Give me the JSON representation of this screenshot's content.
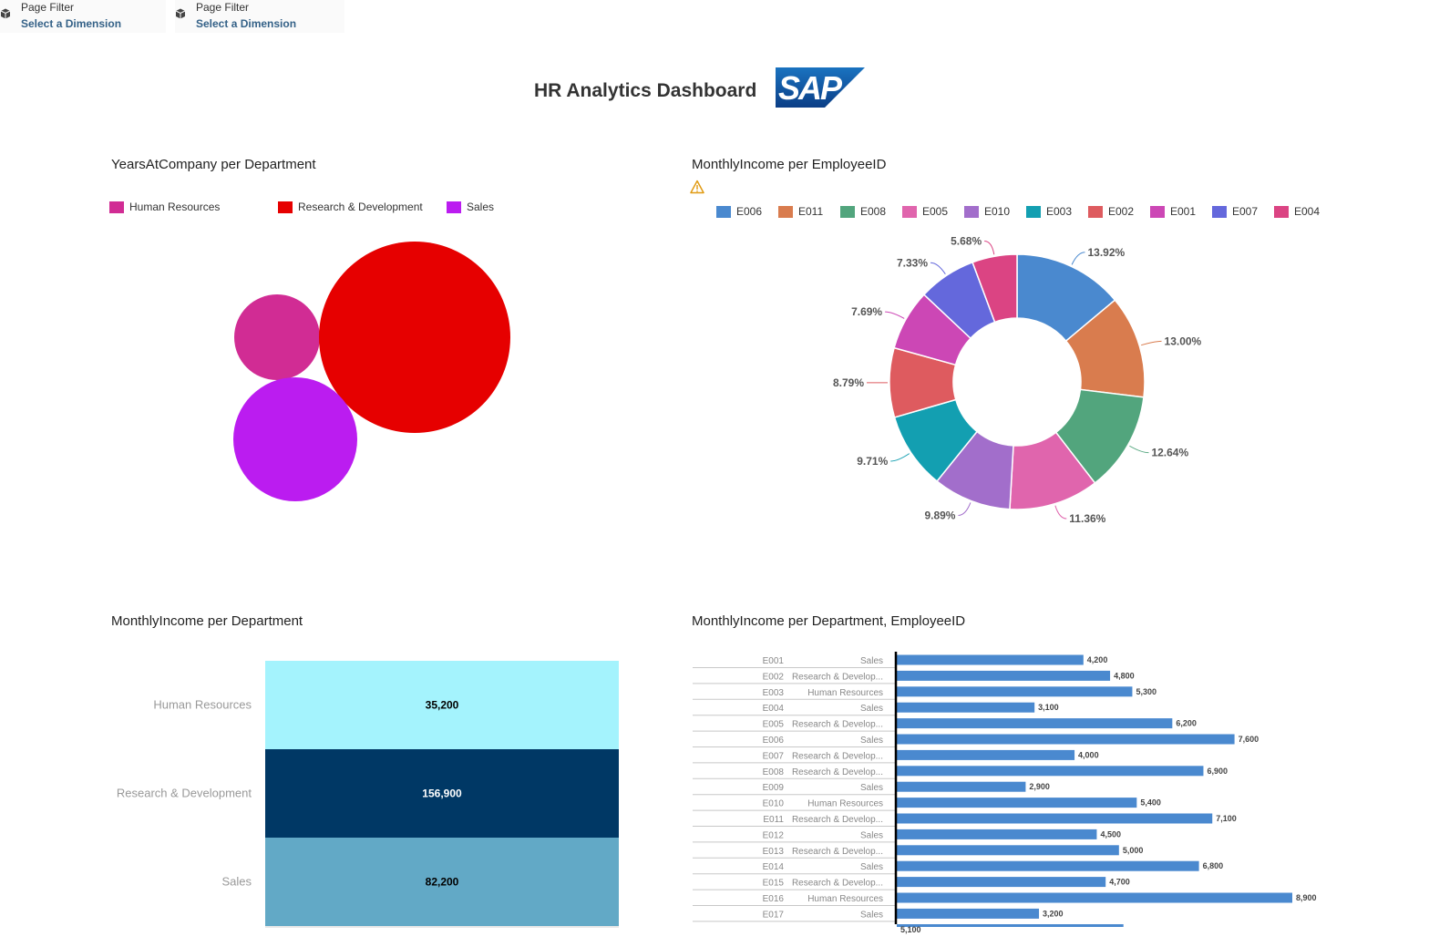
{
  "filters": [
    {
      "label": "Page Filter",
      "value": "Select a Dimension"
    },
    {
      "label": "Page Filter",
      "value": "Select a Dimension"
    }
  ],
  "dashboard": {
    "title": "HR Analytics Dashboard",
    "logo_text": "SAP"
  },
  "icons": {
    "filter": "cube-icon",
    "warning": "warning-icon"
  },
  "colors": {
    "human_resources": "#d12c94",
    "research_development": "#e60000",
    "sales": "#bb1cf0",
    "hbar": "#4a89cf",
    "stack_hr": "#a4f3fd",
    "stack_rd": "#003865",
    "stack_sales": "#62a9c6"
  },
  "widgets": {
    "bubble": {
      "title": "YearsAtCompany per Department"
    },
    "donut": {
      "title": "MonthlyIncome per EmployeeID"
    },
    "stack": {
      "title": "MonthlyIncome per Department"
    },
    "hbar": {
      "title": "MonthlyIncome per Department, EmployeeID"
    }
  },
  "chart_data": [
    {
      "type": "bubble",
      "title": "YearsAtCompany per Department",
      "legend": [
        "Human Resources",
        "Research & Development",
        "Sales"
      ],
      "legend_position": "top-left",
      "series": [
        {
          "name": "Human Resources",
          "color": "#d12c94",
          "relative_size": 0.44
        },
        {
          "name": "Research & Development",
          "color": "#e60000",
          "relative_size": 1.0
        },
        {
          "name": "Sales",
          "color": "#bb1cf0",
          "relative_size": 0.65
        }
      ]
    },
    {
      "type": "pie",
      "subtype": "donut",
      "title": "MonthlyIncome per EmployeeID",
      "legend_position": "top",
      "slices": [
        {
          "name": "E006",
          "label": "13.92%",
          "value": 13.92,
          "color": "#4a89cf"
        },
        {
          "name": "E011",
          "label": "13.00%",
          "value": 13.0,
          "color": "#d97c4e"
        },
        {
          "name": "E008",
          "label": "12.64%",
          "value": 12.64,
          "color": "#52a57d"
        },
        {
          "name": "E005",
          "label": "11.36%",
          "value": 11.36,
          "color": "#e065ad"
        },
        {
          "name": "E010",
          "label": "9.89%",
          "value": 9.89,
          "color": "#a26ecb"
        },
        {
          "name": "E003",
          "label": "9.71%",
          "value": 9.71,
          "color": "#139fb1"
        },
        {
          "name": "E002",
          "label": "8.79%",
          "value": 8.79,
          "color": "#de5b5f"
        },
        {
          "name": "E001",
          "label": "7.69%",
          "value": 7.69,
          "color": "#cc47b5"
        },
        {
          "name": "E007",
          "label": "7.33%",
          "value": 7.33,
          "color": "#6468dc"
        },
        {
          "name": "E004",
          "label": "5.68%",
          "value": 5.68,
          "color": "#db4483"
        }
      ]
    },
    {
      "type": "bar",
      "subtype": "stacked-100",
      "title": "MonthlyIncome per Department",
      "categories": [
        "Human Resources",
        "Research & Development",
        "Sales"
      ],
      "values": [
        35200,
        156900,
        82200
      ],
      "labels": [
        "35,200",
        "156,900",
        "82,200"
      ],
      "colors": [
        "#a4f3fd",
        "#003865",
        "#62a9c6"
      ],
      "label_colors": [
        "#000000",
        "#ffffff",
        "#000000"
      ]
    },
    {
      "type": "bar",
      "orientation": "horizontal",
      "title": "MonthlyIncome per Department, EmployeeID",
      "xlim": [
        0,
        9500
      ],
      "rows": [
        {
          "employee": "E001",
          "department": "Sales",
          "value": 4200,
          "label": "4,200"
        },
        {
          "employee": "E002",
          "department": "Research & Develop...",
          "value": 4800,
          "label": "4,800"
        },
        {
          "employee": "E003",
          "department": "Human Resources",
          "value": 5300,
          "label": "5,300"
        },
        {
          "employee": "E004",
          "department": "Sales",
          "value": 3100,
          "label": "3,100"
        },
        {
          "employee": "E005",
          "department": "Research & Develop...",
          "value": 6200,
          "label": "6,200"
        },
        {
          "employee": "E006",
          "department": "Sales",
          "value": 7600,
          "label": "7,600"
        },
        {
          "employee": "E007",
          "department": "Research & Develop...",
          "value": 4000,
          "label": "4,000"
        },
        {
          "employee": "E008",
          "department": "Research & Develop...",
          "value": 6900,
          "label": "6,900"
        },
        {
          "employee": "E009",
          "department": "Sales",
          "value": 2900,
          "label": "2,900"
        },
        {
          "employee": "E010",
          "department": "Human Resources",
          "value": 5400,
          "label": "5,400"
        },
        {
          "employee": "E011",
          "department": "Research & Develop...",
          "value": 7100,
          "label": "7,100"
        },
        {
          "employee": "E012",
          "department": "Sales",
          "value": 4500,
          "label": "4,500"
        },
        {
          "employee": "E013",
          "department": "Research & Develop...",
          "value": 5000,
          "label": "5,000"
        },
        {
          "employee": "E014",
          "department": "Sales",
          "value": 6800,
          "label": "6,800"
        },
        {
          "employee": "E015",
          "department": "Research & Develop...",
          "value": 4700,
          "label": "4,700"
        },
        {
          "employee": "E016",
          "department": "Human Resources",
          "value": 8900,
          "label": "8,900"
        },
        {
          "employee": "E017",
          "department": "Sales",
          "value": 3200,
          "label": "3,200"
        },
        {
          "employee": "",
          "department": "",
          "value": 5100,
          "label": "5,100"
        }
      ]
    }
  ]
}
